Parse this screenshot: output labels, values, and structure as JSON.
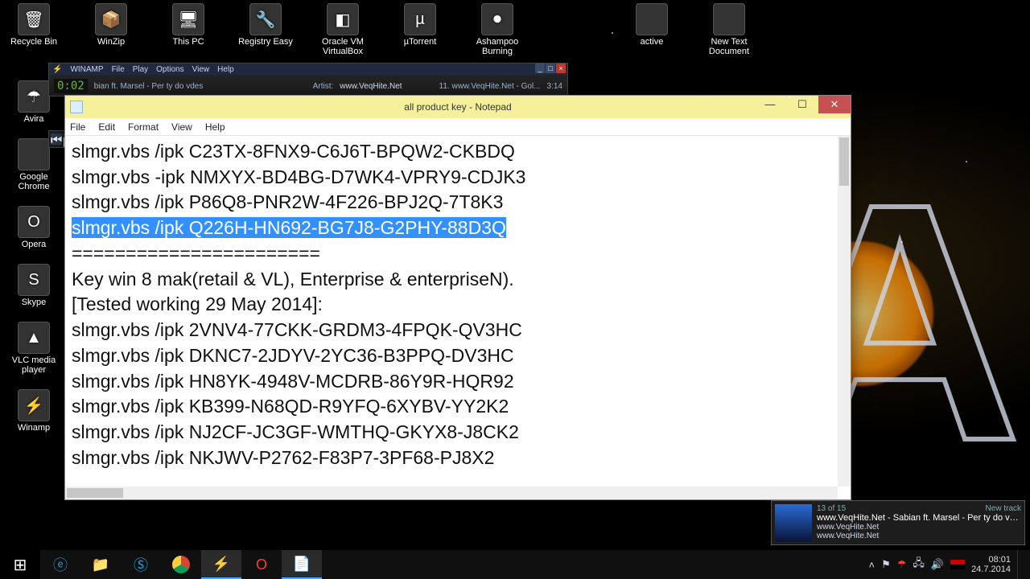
{
  "desktop": {
    "row1": [
      "Recycle Bin",
      "WinZip",
      "This PC",
      "Registry Easy",
      "Oracle VM VirtualBox",
      "µTorrent",
      "Ashampoo Burning",
      "active",
      "New Text Document"
    ],
    "col": [
      "Avira",
      "Google Chrome",
      "Opera",
      "Skype",
      "VLC media player",
      "Winamp"
    ]
  },
  "winamp": {
    "menu": [
      "WINAMP",
      "File",
      "Play",
      "Options",
      "View",
      "Help"
    ],
    "time": "0:02",
    "track": "bian ft. Marsel - Per ty do vdes",
    "artist_label": "Artist:",
    "artist": "www.VeqHite.Net",
    "pl_item": "11. www.VeqHite.Net - Gol...",
    "pl_time": "3:14"
  },
  "notepad": {
    "title": "all product key - Notepad",
    "menu": [
      "File",
      "Edit",
      "Format",
      "View",
      "Help"
    ],
    "lines": [
      "slmgr.vbs /ipk C23TX-8FNX9-C6J6T-BPQW2-CKBDQ",
      "slmgr.vbs -ipk NMXYX-BD4BG-D7WK4-VPRY9-CDJK3",
      "slmgr.vbs /ipk P86Q8-PNR2W-4F226-BPJ2Q-7T8K3",
      "slmgr.vbs /ipk Q226H-HN692-BG7J8-G2PHY-88D3Q",
      "=======================",
      "Key win 8 mak(retail & VL), Enterprise & enterpriseN).",
      "[Tested working 29 May 2014]:",
      "slmgr.vbs /ipk 2VNV4-77CKK-GRDM3-4FPQK-QV3HC",
      "slmgr.vbs /ipk DKNC7-2JDYV-2YC36-B3PPQ-DV3HC",
      "slmgr.vbs /ipk HN8YK-4948V-MCDRB-86Y9R-HQR92",
      "slmgr.vbs /ipk KB399-N68QD-R9YFQ-6XYBV-YY2K2",
      "slmgr.vbs /ipk NJ2CF-JC3GF-WMTHQ-GKYX8-J8CK2",
      "slmgr.vbs /ipk NKJWV-P2762-F83P7-3PF68-PJ8X2"
    ],
    "selected_index": 3
  },
  "toast": {
    "counter": "13 of 15",
    "badge": "New track",
    "title": "www.VeqHite.Net - Sabian ft. Marsel - Per ty do vdes",
    "sub": "www.VeqHite.Net",
    "sub2": "www.VeqHite.Net"
  },
  "taskbar": {
    "time": "08:01",
    "date": "24.7.2014"
  }
}
